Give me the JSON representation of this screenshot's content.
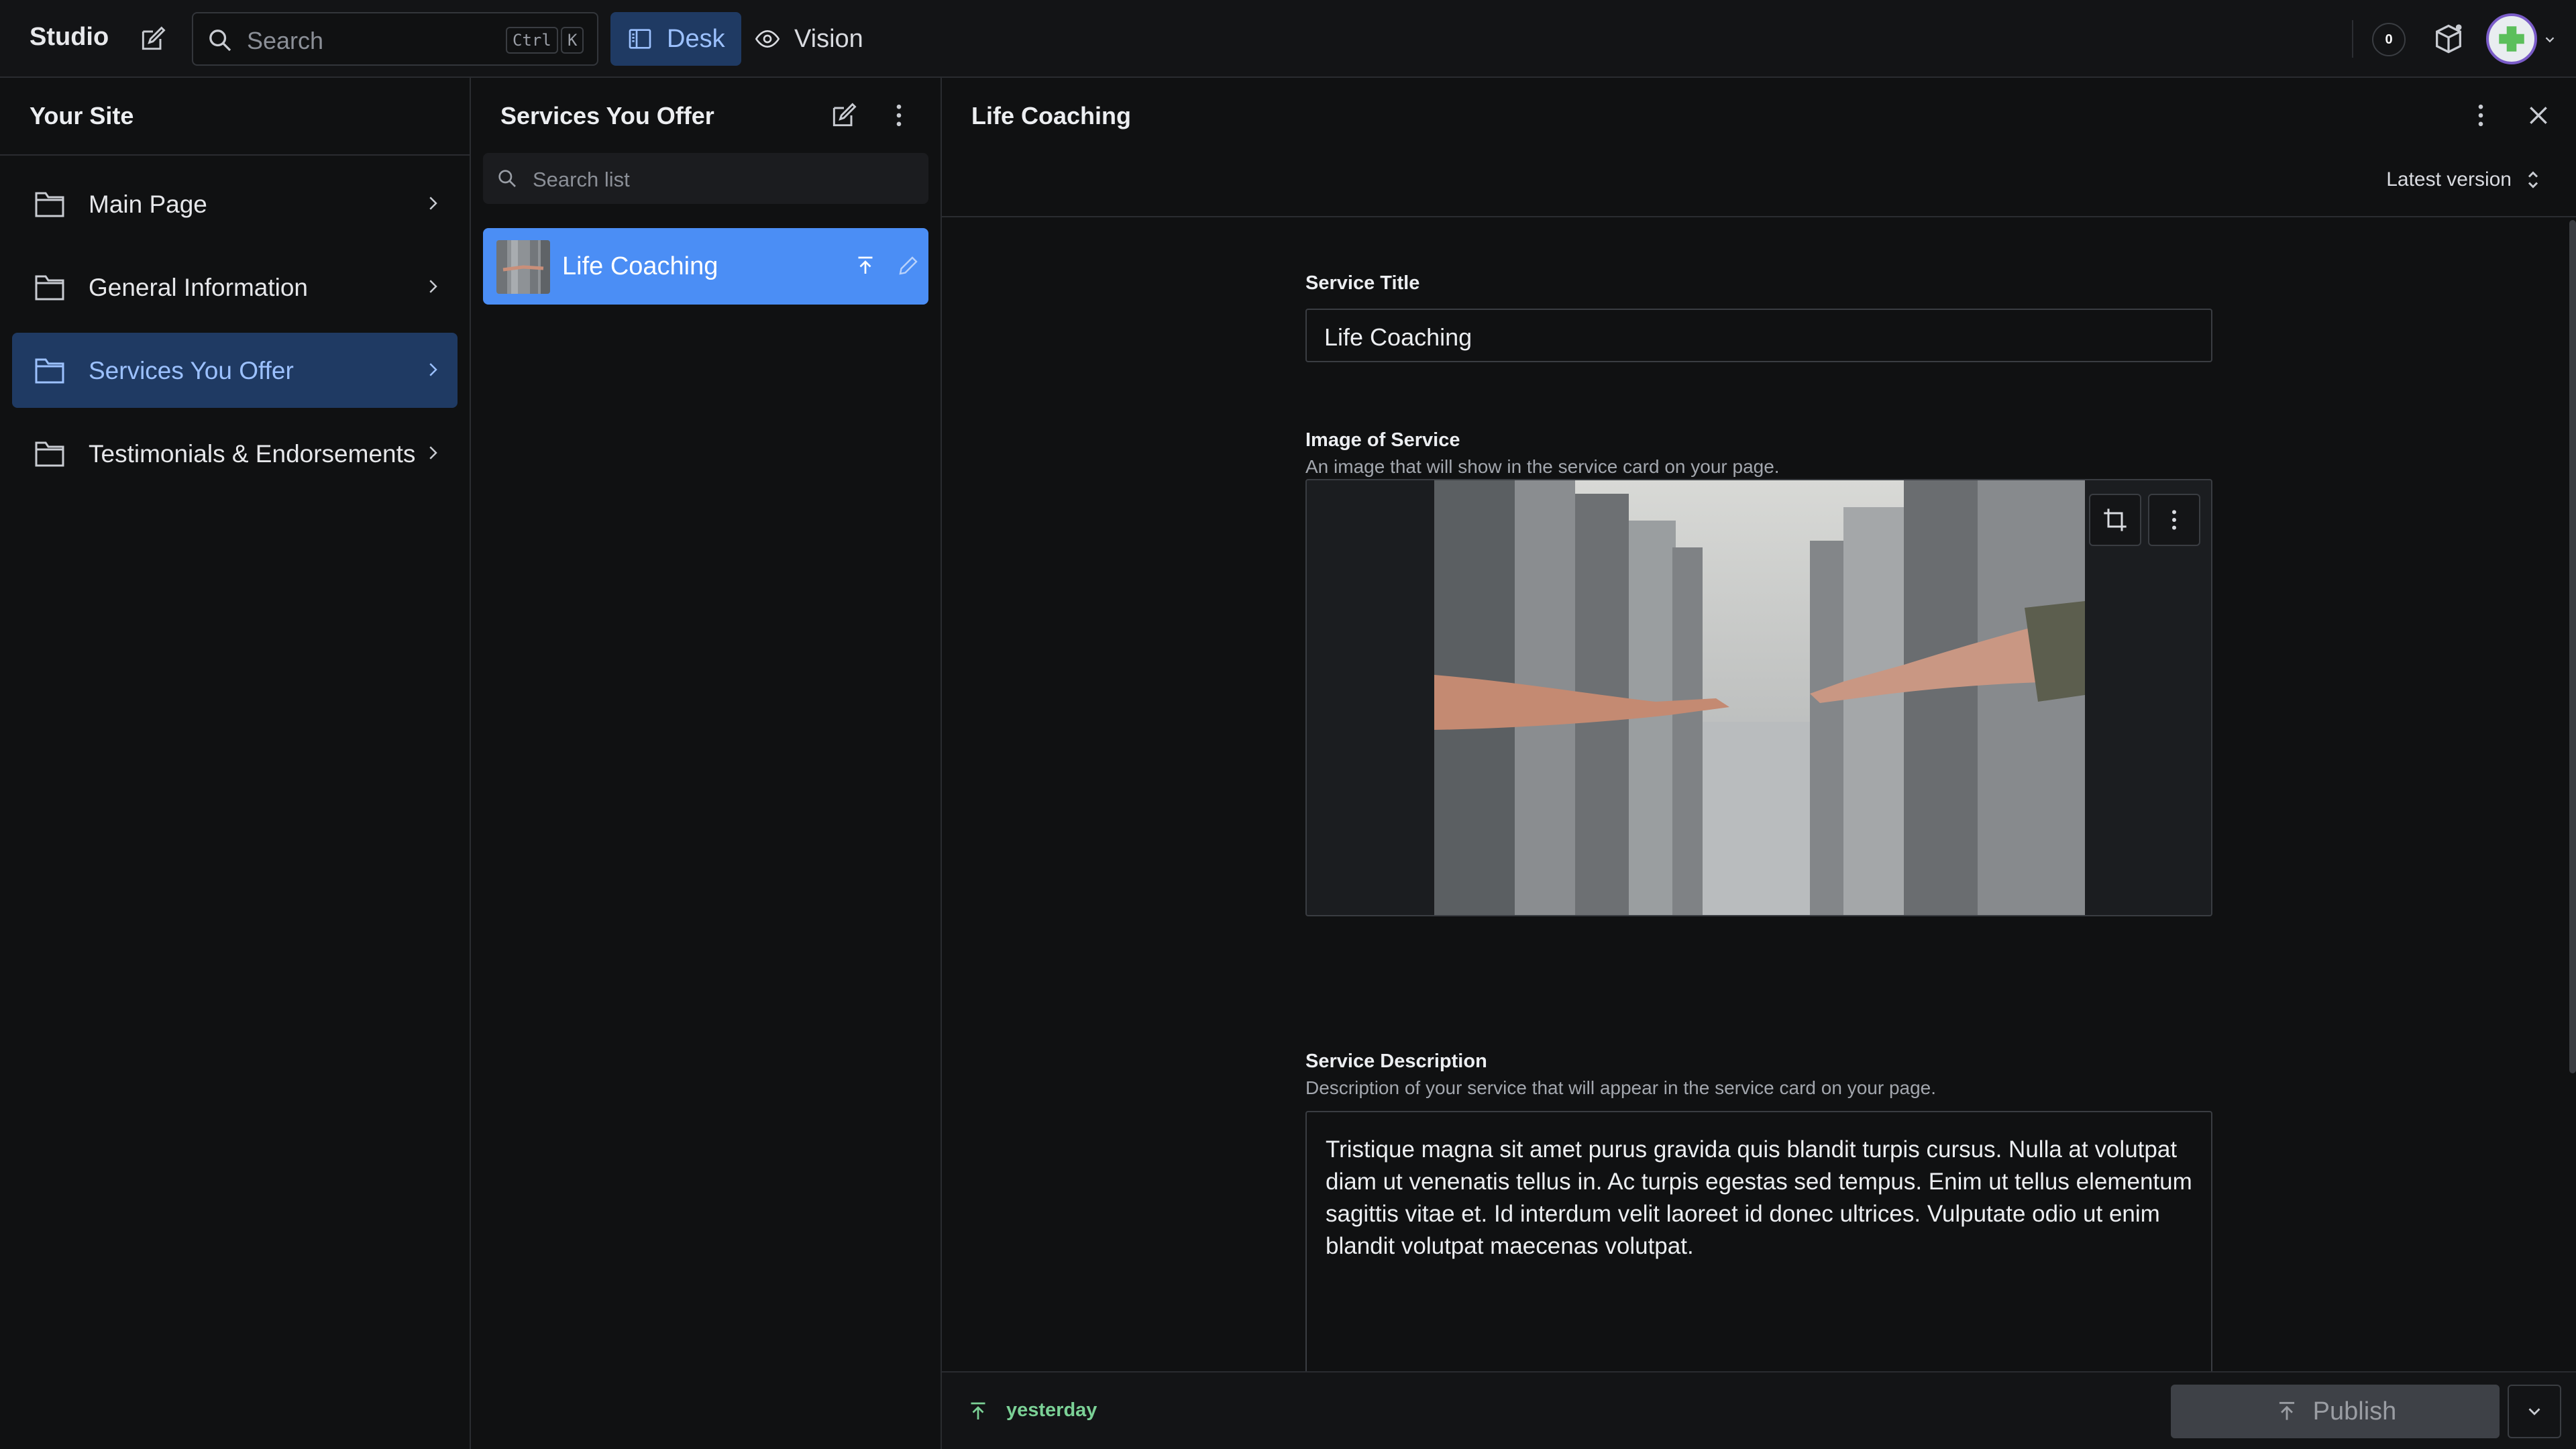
{
  "topbar": {
    "brand": "Studio",
    "search_placeholder": "Search",
    "shortcut_keys": [
      "Ctrl",
      "K"
    ],
    "tabs": [
      {
        "label": "Desk",
        "active": true
      },
      {
        "label": "Vision",
        "active": false
      }
    ],
    "notification_count": "0"
  },
  "sidebar": {
    "title": "Your Site",
    "items": [
      {
        "label": "Main Page",
        "active": false
      },
      {
        "label": "General Information",
        "active": false
      },
      {
        "label": "Services You Offer",
        "active": true
      },
      {
        "label": "Testimonials & Endorsements",
        "active": false
      }
    ]
  },
  "list_pane": {
    "title": "Services You Offer",
    "search_placeholder": "Search list",
    "items": [
      {
        "label": "Life Coaching",
        "selected": true
      }
    ]
  },
  "editor": {
    "title": "Life Coaching",
    "version": "Latest version",
    "fields": {
      "title": {
        "label": "Service Title",
        "value": "Life Coaching"
      },
      "image": {
        "label": "Image of Service",
        "description": "An image that will show in the service card on your page."
      },
      "description": {
        "label": "Service Description",
        "description": "Description of your service that will appear in the service card on your page.",
        "value": "Tristique magna sit amet purus gravida quis blandit turpis cursus. Nulla at volutpat diam ut venenatis tellus in. Ac turpis egestas sed tempus. Enim ut tellus elementum sagittis vitae et. Id interdum velit laoreet id donec ultrices. Vulputate odio ut enim blandit volutpat maecenas volutpat."
      }
    },
    "footer": {
      "published": "yesterday",
      "publish_label": "Publish"
    }
  },
  "colors": {
    "accent": "#4b8ef5",
    "active_nav_bg": "#1f3a63",
    "published_green": "#7bd196",
    "background": "#101112"
  }
}
